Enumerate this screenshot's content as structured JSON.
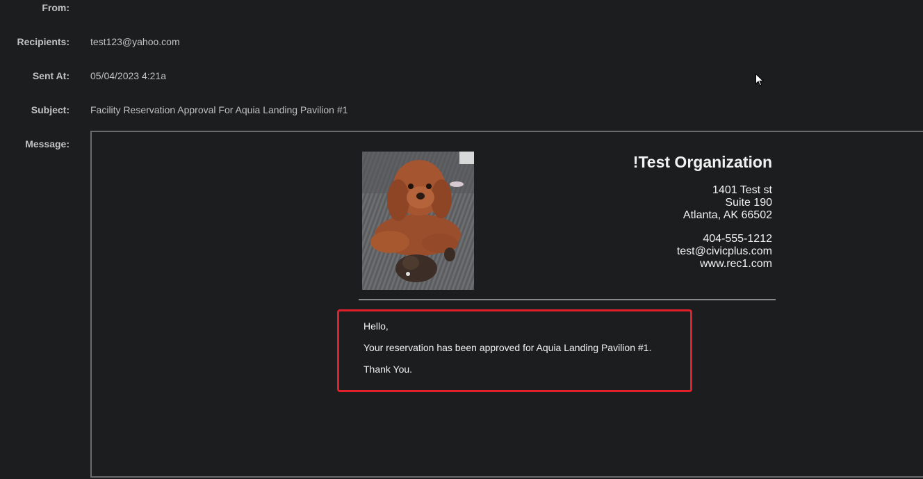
{
  "fields": {
    "from": {
      "label": "From:",
      "value": ""
    },
    "recipients": {
      "label": "Recipients:",
      "value": "test123@yahoo.com"
    },
    "sent_at": {
      "label": "Sent At:",
      "value": "05/04/2023 4:21a"
    },
    "subject": {
      "label": "Subject:",
      "value": "Facility Reservation Approval For Aquia Landing Pavilion #1"
    },
    "message": {
      "label": "Message:"
    }
  },
  "email": {
    "organization": "!Test Organization",
    "address_line1": "1401 Test st",
    "address_line2": "Suite 190",
    "address_line3": "Atlanta, AK 66502",
    "phone": "404-555-1212",
    "contact_email": "test@civicplus.com",
    "website": "www.rec1.com",
    "body": {
      "greeting": "Hello,",
      "text": "Your reservation has been approved for Aquia Landing Pavilion #1.",
      "closing": "Thank You."
    }
  },
  "colors": {
    "background": "#1c1d1f",
    "highlight_border": "#e0202a",
    "text": "#c2c2c2",
    "email_text": "#f2f2f2"
  }
}
